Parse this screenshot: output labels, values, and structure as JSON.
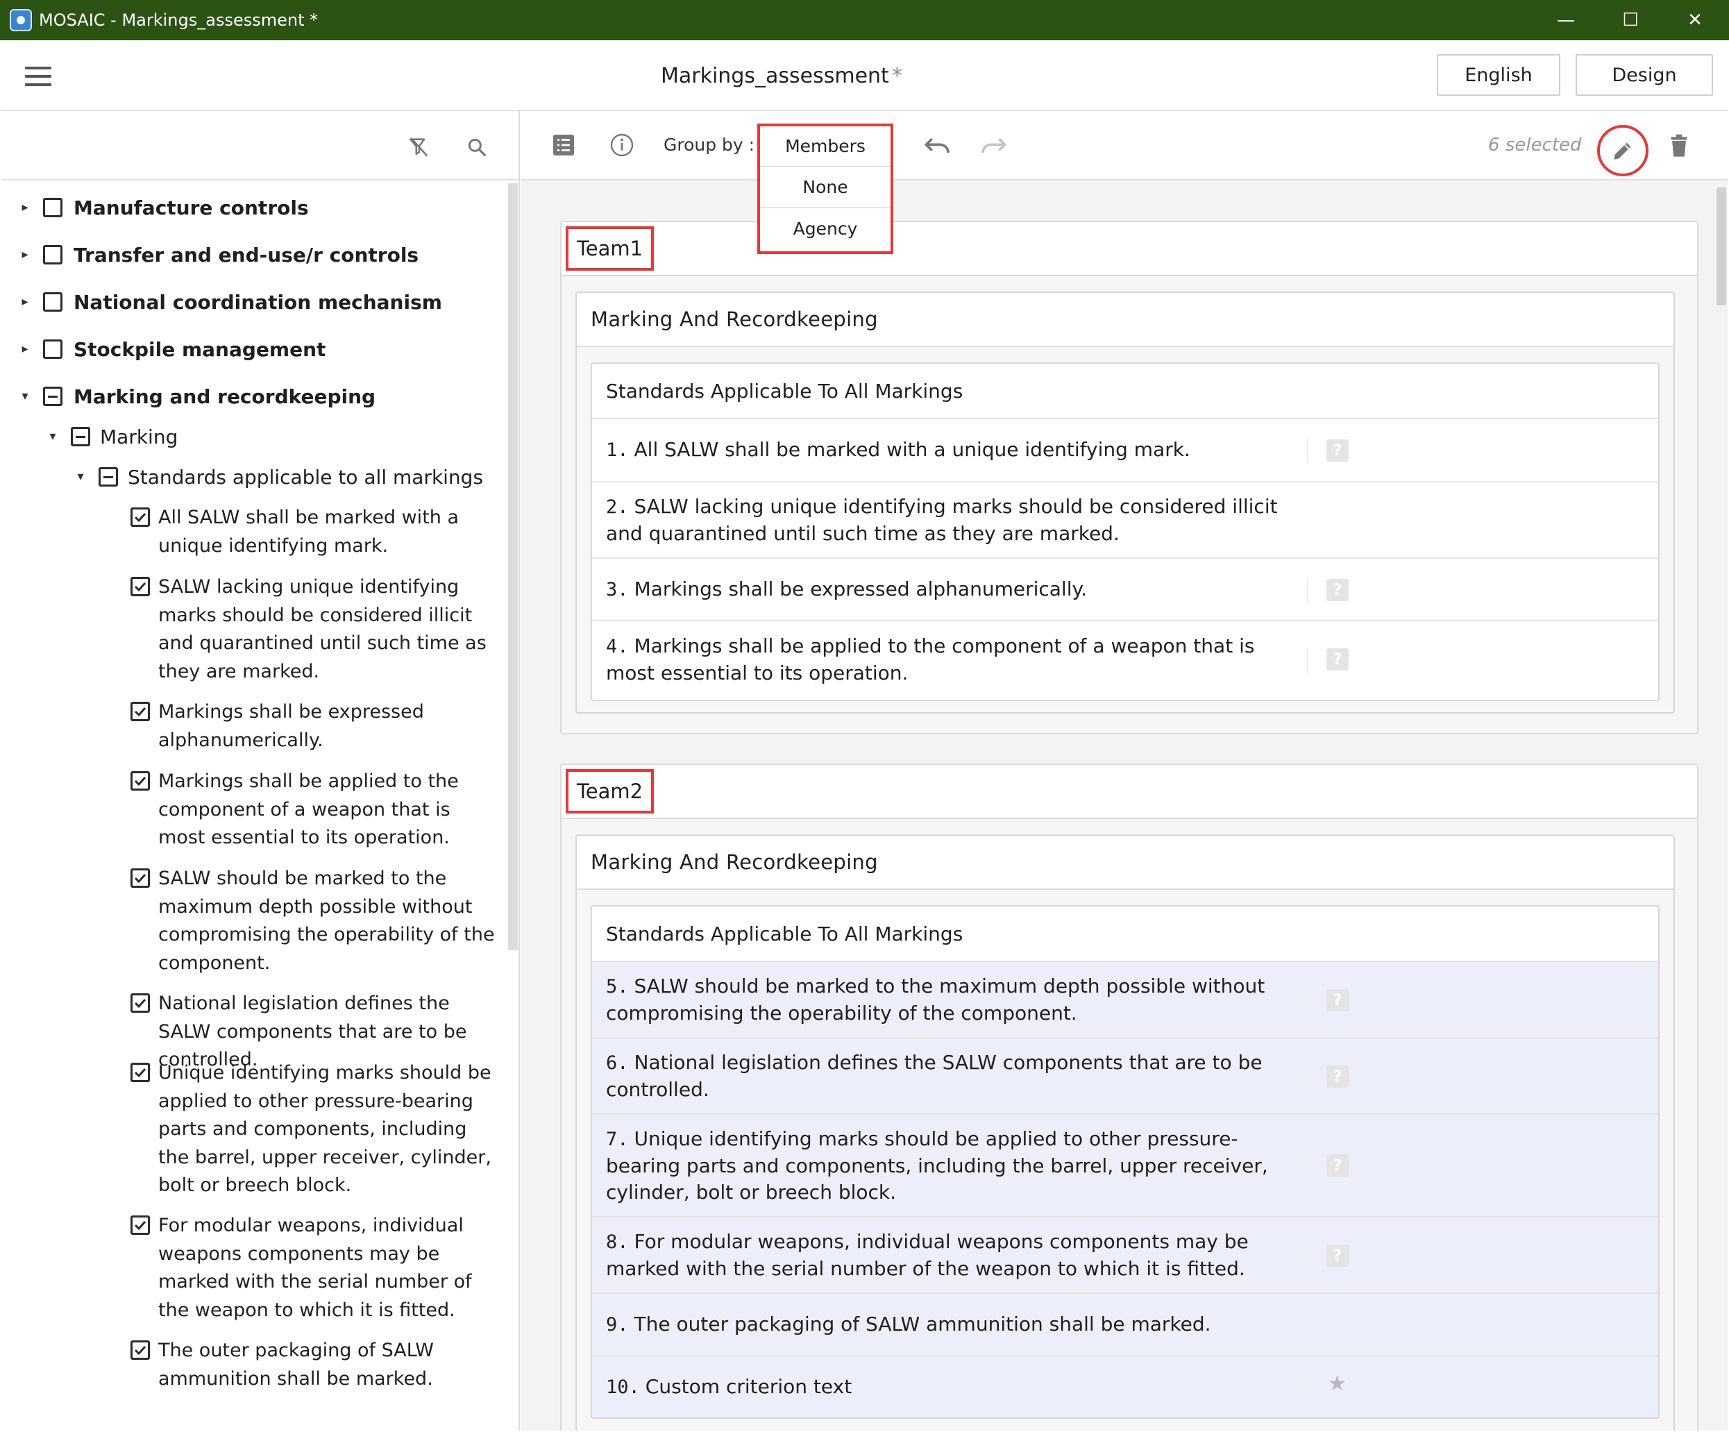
{
  "window": {
    "title": "MOSAIC - Markings_assessment *",
    "minimize": "—",
    "maximize": "☐",
    "close": "✕"
  },
  "header": {
    "doc_title": "Markings_assessment",
    "modified_mark": "*",
    "language_button": "English",
    "design_button": "Design"
  },
  "tree": {
    "top_items": [
      {
        "label": "Manufacture controls"
      },
      {
        "label": "Transfer and end-use/r controls"
      },
      {
        "label": "National coordination mechanism"
      },
      {
        "label": "Stockpile management"
      },
      {
        "label": "Marking and recordkeeping"
      }
    ],
    "marking": "Marking",
    "standards": "Standards applicable to all markings",
    "leaves": [
      "All SALW shall be marked with a unique identifying mark.",
      "SALW lacking unique identifying marks should be considered illicit and quarantined until such time as they are marked.",
      "Markings shall be expressed alphanumerically.",
      "Markings shall be applied to the component of a weapon that is most essential to its operation.",
      "SALW should be marked to the maximum depth possible without compromising the operability of the component.",
      "National legislation defines the SALW components that are to be controlled.",
      "Unique identifying marks should be applied to other pressure-bearing parts and components, including the barrel, upper receiver, cylinder, bolt or breech block.",
      "For modular weapons, individual weapons components may be marked with the serial number of the weapon to which it is fitted.",
      "The outer packaging of SALW ammunition shall be marked."
    ]
  },
  "toolbar": {
    "group_by_label": "Group by :",
    "group_by_options": [
      "Members",
      "None",
      "Agency"
    ],
    "selected_count": "6 selected"
  },
  "groups": [
    {
      "team": "Team1",
      "section": "Marking And Recordkeeping",
      "subsection": "Standards Applicable To All Markings",
      "criteria": [
        {
          "num": "1.",
          "text": "All SALW shall be marked with a unique identifying mark."
        },
        {
          "num": "2.",
          "text": "SALW lacking unique identifying marks should be considered illicit and quarantined until such time as they are marked."
        },
        {
          "num": "3.",
          "text": "Markings shall be expressed alphanumerically."
        },
        {
          "num": "4.",
          "text": "Markings shall be applied to the component of a weapon that is most essential to its operation."
        }
      ]
    },
    {
      "team": "Team2",
      "section": "Marking And Recordkeeping",
      "subsection": "Standards Applicable To All Markings",
      "criteria": [
        {
          "num": "5.",
          "text": "SALW should be marked to the maximum depth possible without compromising the operability of the component."
        },
        {
          "num": "6.",
          "text": "National legislation defines the SALW components that are to be controlled."
        },
        {
          "num": "7.",
          "text": "Unique identifying marks should be applied to other pressure-bearing parts and components, including the barrel, upper receiver, cylinder, bolt or breech block."
        },
        {
          "num": "8.",
          "text": "For modular weapons, individual weapons components may be marked with the serial number of the weapon to which it is fitted."
        },
        {
          "num": "9.",
          "text": "The outer packaging of SALW ammunition shall be marked."
        },
        {
          "num": "10.",
          "text": "Custom criterion text"
        }
      ]
    }
  ],
  "help_glyph": "?",
  "star_glyph": "★",
  "colors": {
    "titlebar": "#2c5214",
    "highlight": "#e23a3a",
    "selected_row": "#eceef9"
  },
  "icons": [
    "app-logo-icon",
    "hamburger-menu-icon",
    "clear-filter-icon",
    "search-icon",
    "list-view-icon",
    "info-icon",
    "undo-icon",
    "redo-icon",
    "edit-pencil-icon",
    "trash-icon",
    "help-icon",
    "star-icon"
  ]
}
